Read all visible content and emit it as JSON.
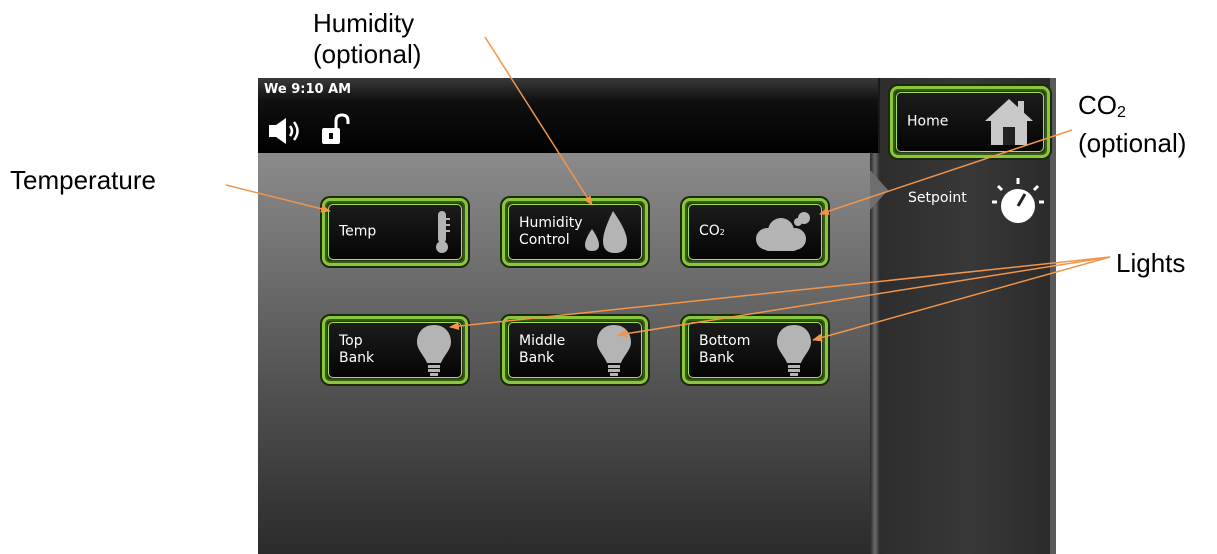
{
  "annotations": {
    "humidity_line1": "Humidity",
    "humidity_line2": "(optional)",
    "co2_main": "CO",
    "co2_sub": "2",
    "co2_line2": "(optional)",
    "temperature": "Temperature",
    "lights": "Lights",
    "arrow_color": "#f0954a"
  },
  "status": {
    "clock": "We 9:10 AM",
    "speaker_icon": "speaker-icon",
    "lock_icon": "unlocked-padlock-icon"
  },
  "tiles": [
    {
      "label": "Temp",
      "icon": "thermometer-icon"
    },
    {
      "label": "Humidity\nControl",
      "icon": "water-drops-icon"
    },
    {
      "label_main": "CO",
      "label_sub": "2",
      "icon": "cloud-icon"
    },
    {
      "label": "Top\nBank",
      "icon": "light-bulb-icon"
    },
    {
      "label": "Middle\nBank",
      "icon": "light-bulb-icon"
    },
    {
      "label": "Bottom\nBank",
      "icon": "light-bulb-icon"
    }
  ],
  "sidebar": {
    "home_label": "Home",
    "home_icon": "house-icon",
    "setpoint_label": "Setpoint",
    "setpoint_icon": "dial-knob-icon"
  },
  "colors": {
    "tile_border": "#88c83c",
    "icon_gray": "#b4b4b4"
  }
}
